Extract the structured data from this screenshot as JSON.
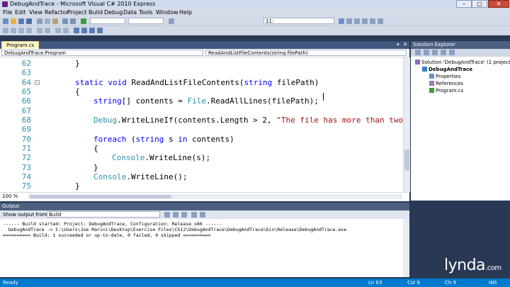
{
  "window": {
    "title": "DebugAndTrace - Microsoft Visual C# 2010 Express",
    "minimize": "–",
    "maximize": "□",
    "close": "✕"
  },
  "menu": [
    "File",
    "Edit",
    "View",
    "Refactor",
    "Project",
    "Build",
    "Debug",
    "Data",
    "Tools",
    "Window",
    "Help"
  ],
  "toolbar": {
    "find_combo": "11:"
  },
  "editor": {
    "tab_label": "Program.cs",
    "nav_left": "DebugAndTrace.Program",
    "nav_right": "ReadAndListFileContents(string filePath)",
    "zoom": "100 %",
    "lines": [
      {
        "n": "62",
        "indent": 2,
        "parts": [
          [
            "",
            "}"
          ]
        ]
      },
      {
        "n": "63",
        "indent": 0,
        "parts": []
      },
      {
        "n": "64",
        "indent": 2,
        "fold": "−",
        "parts": [
          [
            "kw",
            "static"
          ],
          [
            "",
            " "
          ],
          [
            "kw",
            "void"
          ],
          [
            "",
            " ReadAndListFileContents("
          ],
          [
            "kw",
            "string"
          ],
          [
            "",
            " filePath)"
          ]
        ]
      },
      {
        "n": "65",
        "indent": 2,
        "parts": [
          [
            "",
            "{"
          ]
        ]
      },
      {
        "n": "66",
        "indent": 3,
        "parts": [
          [
            "kw",
            "string"
          ],
          [
            "",
            "[] contents = "
          ],
          [
            "ty",
            "File"
          ],
          [
            "",
            ".ReadAllLines(filePath);"
          ]
        ]
      },
      {
        "n": "67",
        "indent": 0,
        "parts": []
      },
      {
        "n": "68",
        "indent": 3,
        "parts": [
          [
            "ty",
            "Debug"
          ],
          [
            "",
            ".WriteLineIf(contents.Length > 2, "
          ],
          [
            "str",
            "\"The file has more than two line"
          ]
        ]
      },
      {
        "n": "69",
        "indent": 0,
        "parts": []
      },
      {
        "n": "70",
        "indent": 3,
        "parts": [
          [
            "kw",
            "foreach"
          ],
          [
            "",
            " ("
          ],
          [
            "kw",
            "string"
          ],
          [
            "",
            " s "
          ],
          [
            "kw",
            "in"
          ],
          [
            "",
            " contents)"
          ]
        ]
      },
      {
        "n": "71",
        "indent": 3,
        "parts": [
          [
            "",
            "{"
          ]
        ]
      },
      {
        "n": "72",
        "indent": 4,
        "parts": [
          [
            "ty",
            "Console"
          ],
          [
            "",
            ".WriteLine(s);"
          ]
        ]
      },
      {
        "n": "73",
        "indent": 3,
        "parts": [
          [
            "",
            "}"
          ]
        ]
      },
      {
        "n": "74",
        "indent": 3,
        "parts": [
          [
            "ty",
            "Console"
          ],
          [
            "",
            ".WriteLine();"
          ]
        ]
      },
      {
        "n": "75",
        "indent": 2,
        "parts": [
          [
            "",
            "}"
          ]
        ]
      }
    ]
  },
  "solution_explorer": {
    "title": "Solution Explorer",
    "items": [
      {
        "label": "Solution 'DebugAndTrace' (1 project)",
        "level": 0,
        "icon": "solution-icon"
      },
      {
        "label": "DebugAndTrace",
        "level": 1,
        "icon": "project-icon",
        "bold": true
      },
      {
        "label": "Properties",
        "level": 2,
        "icon": "properties-icon"
      },
      {
        "label": "References",
        "level": 2,
        "icon": "references-icon"
      },
      {
        "label": "Program.cs",
        "level": 2,
        "icon": "csfile-icon"
      }
    ]
  },
  "output": {
    "title": "Output",
    "show_from_label": "Show output from:",
    "show_from_value": "Build",
    "lines": [
      "------ Build started: Project: DebugAndTrace, Configuration: Release x86 ------",
      "  DebugAndTrace -> C:\\Users\\Joe Marini\\Desktop\\Exercise Files\\Ch12\\DebugAndTrace\\DebugAndTrace\\bin\\Release\\DebugAndTrace.exe",
      "========== Build: 1 succeeded or up-to-date, 0 failed, 0 skipped =========="
    ]
  },
  "status": {
    "ready": "Ready",
    "ln": "Ln 63",
    "col": "Col 9",
    "ch": "Ch 9",
    "ins": "INS"
  },
  "watermark": {
    "brand": "lynda",
    "suffix": ".com"
  },
  "colors": {
    "keyword": "#0000ff",
    "type": "#2b91af",
    "string": "#a31515",
    "linenum": "#2b91af",
    "tab_active": "#fff6c7"
  }
}
